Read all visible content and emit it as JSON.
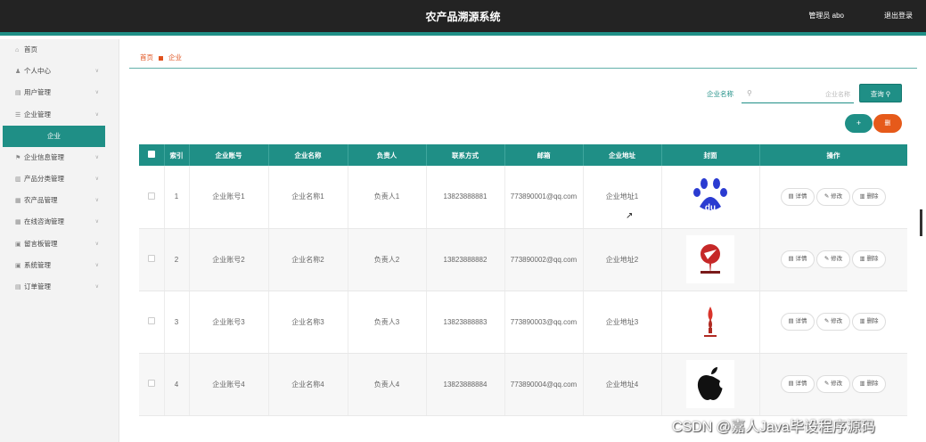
{
  "header": {
    "title": "农产品溯源系统",
    "user": "管理员 abo",
    "logout": "退出登录"
  },
  "sidebar": {
    "items": [
      {
        "label": "首页",
        "icon": "home-icon",
        "arrow": false
      },
      {
        "label": "个人中心",
        "icon": "user-icon",
        "arrow": true
      },
      {
        "label": "用户管理",
        "icon": "users-icon",
        "arrow": true
      },
      {
        "label": "企业管理",
        "icon": "list-icon",
        "arrow": true
      },
      {
        "label": "企业",
        "sub": true
      },
      {
        "label": "企业信息管理",
        "icon": "flag-icon",
        "arrow": true
      },
      {
        "label": "产品分类管理",
        "icon": "bar-chart-icon",
        "arrow": true
      },
      {
        "label": "农产品管理",
        "icon": "grid-icon",
        "arrow": true
      },
      {
        "label": "在线咨询管理",
        "icon": "grid-icon",
        "arrow": true
      },
      {
        "label": "留言板管理",
        "icon": "message-icon",
        "arrow": true
      },
      {
        "label": "系统管理",
        "icon": "settings-icon",
        "arrow": true
      },
      {
        "label": "订单管理",
        "icon": "order-icon",
        "arrow": true
      }
    ]
  },
  "breadcrumb": {
    "home": "首页",
    "current": "企业"
  },
  "search": {
    "label": "企业名称",
    "placeholder": "企业名称",
    "button": "查询"
  },
  "actions": {
    "add": "+",
    "delete": "删"
  },
  "table": {
    "headers": [
      "索引",
      "企业账号",
      "企业名称",
      "负责人",
      "联系方式",
      "邮箱",
      "企业地址",
      "封面",
      "操作"
    ],
    "rows": [
      {
        "index": "1",
        "account": "企业账号1",
        "name": "企业名称1",
        "person": "负责人1",
        "phone": "13823888881",
        "email": "773890001@qq.com",
        "address": "企业地址1",
        "logo": "baidu"
      },
      {
        "index": "2",
        "account": "企业账号2",
        "name": "企业名称2",
        "person": "负责人2",
        "phone": "13823888882",
        "email": "773890002@qq.com",
        "address": "企业地址2",
        "logo": "red-emblem"
      },
      {
        "index": "3",
        "account": "企业账号3",
        "name": "企业名称3",
        "person": "负责人3",
        "phone": "13823888883",
        "email": "773890003@qq.com",
        "address": "企业地址3",
        "logo": "torch"
      },
      {
        "index": "4",
        "account": "企业账号4",
        "name": "企业名称4",
        "person": "负责人4",
        "phone": "13823888884",
        "email": "773890004@qq.com",
        "address": "企业地址4",
        "logo": "apple"
      }
    ],
    "ops": {
      "detail": "详情",
      "edit": "修改",
      "delete": "删除"
    }
  },
  "watermark": "CSDN @嘉人Java毕设程序源码",
  "colors": {
    "accent": "#1f8f86",
    "danger": "#e65a1a",
    "topbar": "#232323"
  }
}
